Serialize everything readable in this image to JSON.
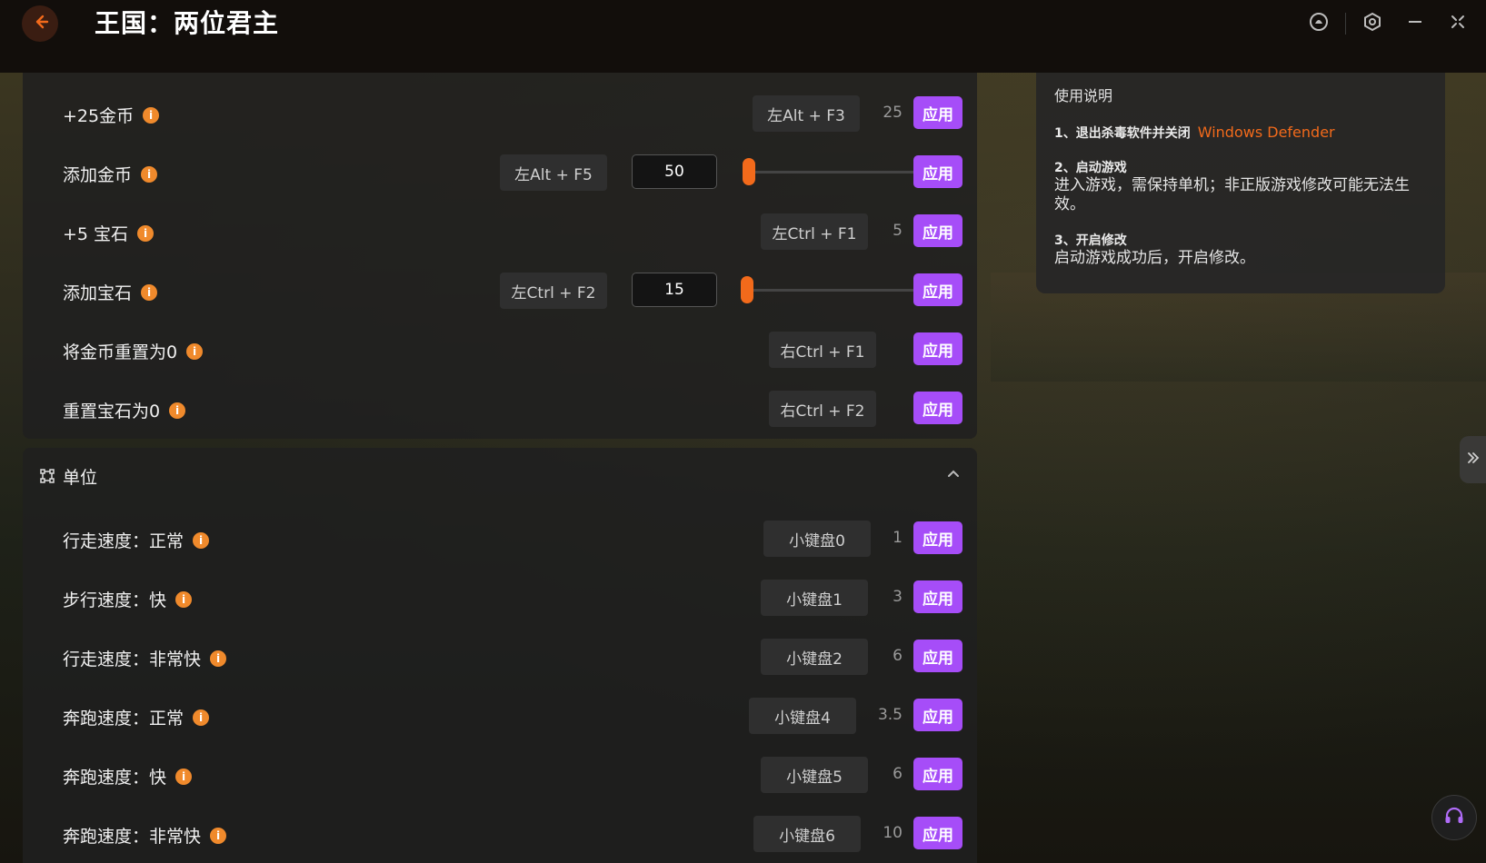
{
  "app": {
    "title": "王国：两位君主"
  },
  "theme": {
    "accent": "#a64df8",
    "slider": "#f26a1b",
    "info": "#f08a2c"
  },
  "icons": {
    "back": "arrow-left-icon",
    "notification": "bell-icon",
    "settings": "gear-icon",
    "minimize": "minimize-icon",
    "close": "close-icon",
    "units_section": "nodes-icon",
    "collapse": "chevron-up-icon",
    "expand_side": "double-chevron-right-icon",
    "support": "headset-icon"
  },
  "resources": {
    "rows": [
      {
        "label": "+25金币",
        "hotkey": "左Alt + F3",
        "value": "25",
        "apply": "应用"
      },
      {
        "label": "添加金币",
        "hotkey": "左Alt + F5",
        "input": "50",
        "slider_fraction": 0.03,
        "apply": "应用"
      },
      {
        "label": "+5 宝石",
        "hotkey": "左Ctrl + F1",
        "value": "5",
        "apply": "应用"
      },
      {
        "label": "添加宝石",
        "hotkey": "左Ctrl + F2",
        "input": "15",
        "slider_fraction": 0.02,
        "apply": "应用"
      },
      {
        "label": "将金币重置为0",
        "hotkey": "右Ctrl + F1",
        "apply": "应用"
      },
      {
        "label": "重置宝石为0",
        "hotkey": "右Ctrl + F2",
        "apply": "应用"
      }
    ]
  },
  "units": {
    "title": "单位",
    "rows": [
      {
        "label": "行走速度：正常",
        "hotkey": "小键盘0",
        "value": "1",
        "apply": "应用"
      },
      {
        "label": "步行速度：快",
        "hotkey": "小键盘1",
        "value": "3",
        "apply": "应用"
      },
      {
        "label": "行走速度：非常快",
        "hotkey": "小键盘2",
        "value": "6",
        "apply": "应用"
      },
      {
        "label": "奔跑速度：正常",
        "hotkey": "小键盘4",
        "value": "3.5",
        "apply": "应用"
      },
      {
        "label": "奔跑速度：快",
        "hotkey": "小键盘5",
        "value": "6",
        "apply": "应用"
      },
      {
        "label": "奔跑速度：非常快",
        "hotkey": "小键盘6",
        "value": "10",
        "apply": "应用"
      }
    ]
  },
  "help": {
    "title": "使用说明",
    "steps": [
      {
        "heading": "1、退出杀毒软件并关闭",
        "accent": "Windows Defender",
        "text": ""
      },
      {
        "heading": "2、启动游戏",
        "text": "进入游戏，需保持单机；非正版游戏修改可能无法生效。"
      },
      {
        "heading": "3、开启修改",
        "text": "启动游戏成功后，开启修改。"
      }
    ]
  }
}
